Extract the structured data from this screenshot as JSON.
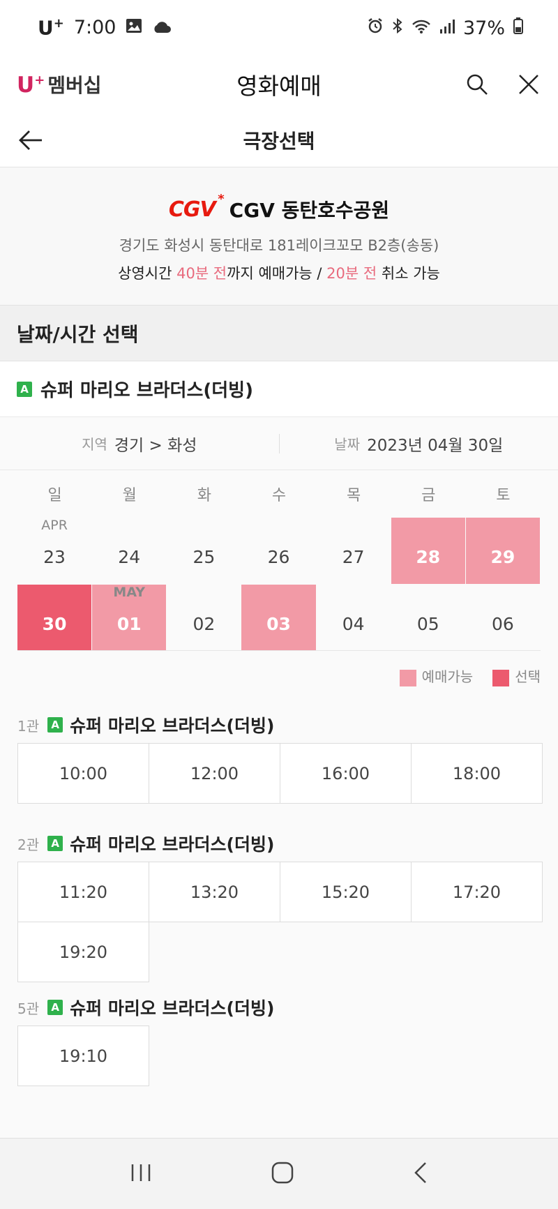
{
  "status_bar": {
    "carrier": "U",
    "carrier_plus": "+",
    "time": "7:00",
    "battery": "37%"
  },
  "app_header": {
    "brand_u": "U",
    "brand_plus": "+",
    "brand_text": "멤버십",
    "title": "영화예매",
    "icons": [
      "search-icon",
      "close-icon"
    ]
  },
  "sub_header": {
    "title": "극장선택"
  },
  "theater": {
    "logo": "CGV",
    "name": "CGV 동탄호수공원",
    "address": "경기도 화성시 동탄대로 181레이크꼬모 B2층(송동)",
    "notice_prefix": "상영시간 ",
    "notice_book": "40분 전",
    "notice_mid": "까지 예매가능 / ",
    "notice_cancel": "20분 전",
    "notice_suffix": " 취소 가능"
  },
  "section": {
    "title": "날짜/시간 선택"
  },
  "movie": {
    "rating": "A",
    "title": "슈퍼 마리오 브라더스(더빙)"
  },
  "filter": {
    "region_label": "지역",
    "region_value": "경기 > 화성",
    "date_label": "날짜",
    "date_value": "2023년 04월 30일"
  },
  "calendar": {
    "weekdays": [
      "일",
      "월",
      "화",
      "수",
      "목",
      "금",
      "토"
    ],
    "days": [
      {
        "day": "23",
        "month": "APR",
        "state": "none"
      },
      {
        "day": "24",
        "month": "",
        "state": "none"
      },
      {
        "day": "25",
        "month": "",
        "state": "none"
      },
      {
        "day": "26",
        "month": "",
        "state": "none"
      },
      {
        "day": "27",
        "month": "",
        "state": "none"
      },
      {
        "day": "28",
        "month": "",
        "state": "available"
      },
      {
        "day": "29",
        "month": "",
        "state": "available"
      },
      {
        "day": "30",
        "month": "",
        "state": "selected"
      },
      {
        "day": "01",
        "month": "MAY",
        "state": "available"
      },
      {
        "day": "02",
        "month": "",
        "state": "none"
      },
      {
        "day": "03",
        "month": "",
        "state": "available"
      },
      {
        "day": "04",
        "month": "",
        "state": "none"
      },
      {
        "day": "05",
        "month": "",
        "state": "none"
      },
      {
        "day": "06",
        "month": "",
        "state": "none"
      }
    ],
    "legend_available": "예매가능",
    "legend_selected": "선택",
    "color_available": "#f29aa6",
    "color_selected": "#ec5a6e"
  },
  "screens": [
    {
      "hall": "1관",
      "rating": "A",
      "title": "슈퍼 마리오 브라더스(더빙)",
      "times": [
        "10:00",
        "12:00",
        "16:00",
        "18:00"
      ]
    },
    {
      "hall": "2관",
      "rating": "A",
      "title": "슈퍼 마리오 브라더스(더빙)",
      "times": [
        "11:20",
        "13:20",
        "15:20",
        "17:20",
        "19:20"
      ]
    },
    {
      "hall": "5관",
      "rating": "A",
      "title": "슈퍼 마리오 브라더스(더빙)",
      "times": [
        "19:10"
      ]
    }
  ],
  "nav_bar": {
    "icons": [
      "recent-apps-icon",
      "home-icon",
      "back-icon"
    ]
  }
}
